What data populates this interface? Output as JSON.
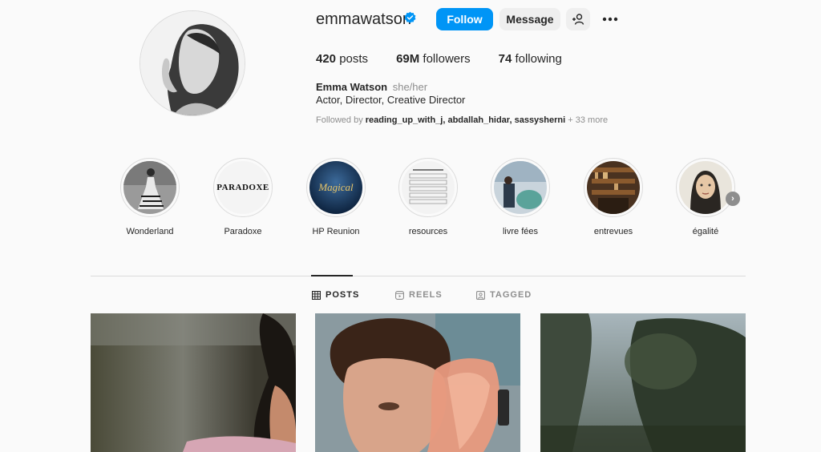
{
  "profile": {
    "username": "emmawatson",
    "verified": true,
    "follow_label": "Follow",
    "message_label": "Message",
    "full_name": "Emma Watson",
    "pronouns": "she/her",
    "bio": "Actor, Director, Creative Director",
    "followed_by_prefix": "Followed by",
    "followed_by_names": "reading_up_with_j, abdallah_hidar, sassysherni",
    "followed_by_more": "+ 33 more"
  },
  "stats": {
    "posts_count": "420",
    "posts_label": "posts",
    "followers_count": "69M",
    "followers_label": "followers",
    "following_count": "74",
    "following_label": "following"
  },
  "highlights": [
    {
      "label": "Wonderland"
    },
    {
      "label": "Paradoxe",
      "cover_text": "PARADOXE"
    },
    {
      "label": "HP Reunion",
      "cover_text": "Magical"
    },
    {
      "label": "resources"
    },
    {
      "label": "livre fées"
    },
    {
      "label": "entrevues"
    },
    {
      "label": "égalité"
    }
  ],
  "tabs": {
    "posts": "POSTS",
    "reels": "REELS",
    "tagged": "TAGGED"
  },
  "icons": {
    "verified": "verified-badge-icon",
    "add_user": "add-person-icon",
    "more": "more-options-icon",
    "grid": "grid-icon",
    "reels": "reels-icon",
    "tagged": "tagged-icon",
    "next": "chevron-right-icon"
  },
  "colors": {
    "accent": "#0095f6",
    "text": "#262626",
    "secondary": "#8e8e8e",
    "background": "#fafafa"
  }
}
